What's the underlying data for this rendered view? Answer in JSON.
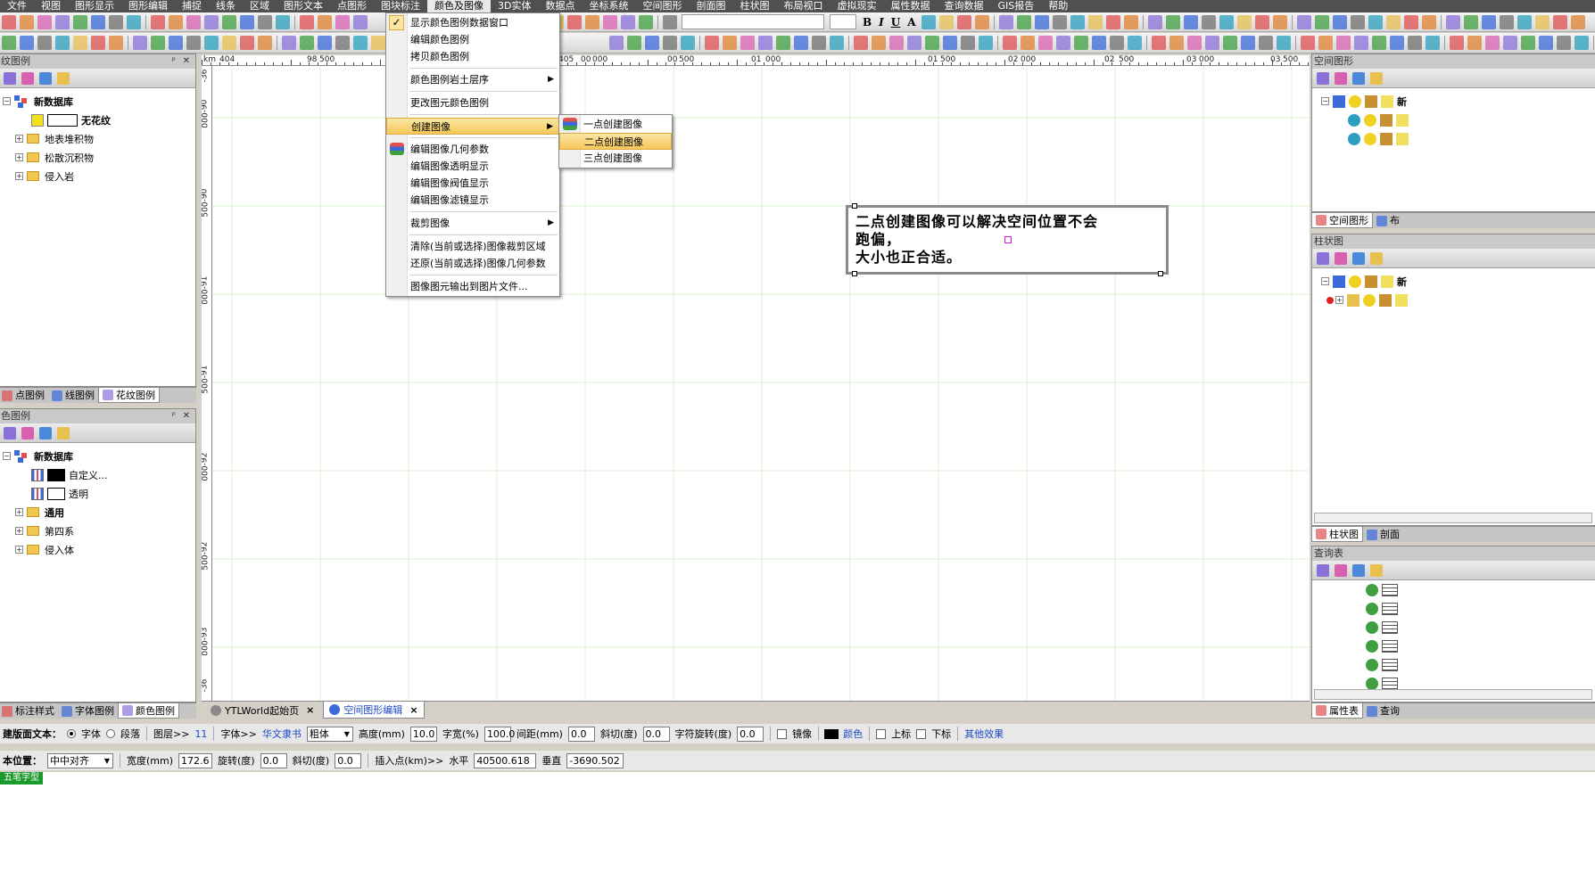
{
  "menubar": {
    "items": [
      "文件",
      "视图",
      "图形显示",
      "图形编辑",
      "捕捉",
      "线条",
      "区域",
      "图形文本",
      "点图形",
      "图块标注",
      "颜色及图像",
      "3D实体",
      "数据点",
      "坐标系统",
      "空间图形",
      "剖面图",
      "柱状图",
      "布局视口",
      "虚拟现实",
      "属性数据",
      "查询数据",
      "GIS报告",
      "帮助"
    ],
    "active": "颜色及图像"
  },
  "toolbar": {
    "font_combo": "",
    "size_combo": "",
    "bold_label": "B",
    "italic_label": "I",
    "underline_label": "U",
    "font_a_label": "A"
  },
  "left_top_panel": {
    "title": "纹图例",
    "tree": [
      {
        "label": "新数据库",
        "kind": "db",
        "bold": true
      },
      {
        "label": "无花纹",
        "kind": "pattern",
        "bold": true
      },
      {
        "label": "地表堆积物",
        "kind": "folder"
      },
      {
        "label": "松散沉积物",
        "kind": "folder"
      },
      {
        "label": "侵入岩",
        "kind": "folder"
      }
    ],
    "tabs": [
      "点图例",
      "线图例",
      "花纹图例"
    ],
    "selected_tab": "花纹图例"
  },
  "left_bottom_panel": {
    "title": "色图例",
    "tree": [
      {
        "label": "新数据库",
        "kind": "db",
        "bold": true
      },
      {
        "label": "自定义...",
        "kind": "color",
        "swatch": "#000000"
      },
      {
        "label": "透明",
        "kind": "color",
        "swatch": "#ffffff"
      },
      {
        "label": "通用",
        "kind": "folder",
        "bold": true
      },
      {
        "label": "第四系",
        "kind": "folder"
      },
      {
        "label": "侵入体",
        "kind": "folder"
      }
    ],
    "tabs": [
      "标注样式",
      "字体图例",
      "颜色图例"
    ],
    "selected_tab": "颜色图例"
  },
  "ruler": {
    "h_labels": [
      "km",
      "404",
      "98",
      "500",
      "405",
      "00",
      "000",
      "00",
      "500",
      "01",
      "000",
      "01",
      "500",
      "02",
      "000",
      "02",
      "500",
      "03",
      "000",
      "03",
      "500",
      "405"
    ],
    "v_labels": [
      "-36",
      "-90",
      "000",
      "-90",
      "500",
      "-91",
      "000",
      "-91",
      "500",
      "-92",
      "000",
      "-92",
      "500",
      "-93",
      "000",
      "-36"
    ]
  },
  "color_image_menu": {
    "items": [
      {
        "label": "显示颜色图例数据窗口",
        "checked": true
      },
      {
        "label": "编辑颜色图例"
      },
      {
        "label": "拷贝颜色图例"
      },
      {
        "sep": true
      },
      {
        "label": "颜色图例岩土层序",
        "submenu": true
      },
      {
        "sep": true
      },
      {
        "label": "更改图元颜色图例"
      },
      {
        "sep": true
      },
      {
        "label": "创建图像",
        "submenu": true,
        "highlight": true
      },
      {
        "sep": true
      },
      {
        "label": "编辑图像几何参数",
        "icon": true
      },
      {
        "label": "编辑图像透明显示"
      },
      {
        "label": "编辑图像阀值显示"
      },
      {
        "label": "编辑图像滤镜显示"
      },
      {
        "sep": true
      },
      {
        "label": "裁剪图像",
        "submenu": true
      },
      {
        "sep": true
      },
      {
        "label": "清除(当前或选择)图像裁剪区域"
      },
      {
        "label": "还原(当前或选择)图像几何参数"
      },
      {
        "sep": true
      },
      {
        "label": "图像图元输出到图片文件..."
      }
    ]
  },
  "create_image_submenu": {
    "items": [
      {
        "label": "一点创建图像",
        "icon": true
      },
      {
        "label": "二点创建图像",
        "highlight": true
      },
      {
        "label": "三点创建图像"
      }
    ]
  },
  "canvas_text": {
    "line1": "二点创建图像可以解决空间位置不会",
    "line2": "跑偏，",
    "line3": "大小也正合适。"
  },
  "right_panels": {
    "top": {
      "title": "空间图形",
      "tabs": [
        "空间图形",
        "布"
      ],
      "node_label": "新"
    },
    "middle": {
      "title": "柱状图",
      "tabs": [
        "柱状图",
        "剖面"
      ],
      "node_label": "新"
    },
    "bottom": {
      "title": "查询表",
      "tabs": [
        "属性表",
        "查询"
      ]
    }
  },
  "doc_tabs": [
    {
      "label": "YTLWorld起始页",
      "selected": false
    },
    {
      "label": "空间图形编辑",
      "selected": true
    }
  ],
  "status1": {
    "prefix": "建版面文本：",
    "radio_font": "字体",
    "radio_para": "段落",
    "layer_label": "图层>>",
    "layer_value": "11",
    "font_label": "字体>>",
    "font_value": "华文隶书",
    "weight_value": "粗体",
    "height_label": "高度(mm)",
    "height_value": "10.0",
    "width_label": "字宽(%)",
    "width_value": "100.0",
    "spacing_label": "间距(mm)",
    "spacing_value": "0.0",
    "italic_label": "斜切(度)",
    "italic_value": "0.0",
    "rotate_label": "字符旋转(度)",
    "rotate_value": "0.0",
    "mirror_label": "镜像",
    "color_label": "颜色",
    "color_value": "#000000",
    "sup_label": "上标",
    "sub_label": "下标",
    "more_label": "其他效果"
  },
  "status2": {
    "pos_label": "本位置：",
    "align_value": "中中对齐",
    "width_label": "宽度(mm)",
    "width_value": "172.6",
    "rotate_label": "旋转(度)",
    "rotate_value": "0.0",
    "italic_label": "斜切(度)",
    "italic_value": "0.0",
    "insert_label": "插入点(km)>>",
    "horiz_label": "水平",
    "horiz_value": "40500.618",
    "vert_label": "垂直",
    "vert_value": "-3690.502",
    "mode_label": "五笔字型"
  },
  "colors": {
    "accent": "#1a49c8",
    "menu_bar": "#505050",
    "highlight": "#f5c85a",
    "grid": "#d8f0d0"
  }
}
